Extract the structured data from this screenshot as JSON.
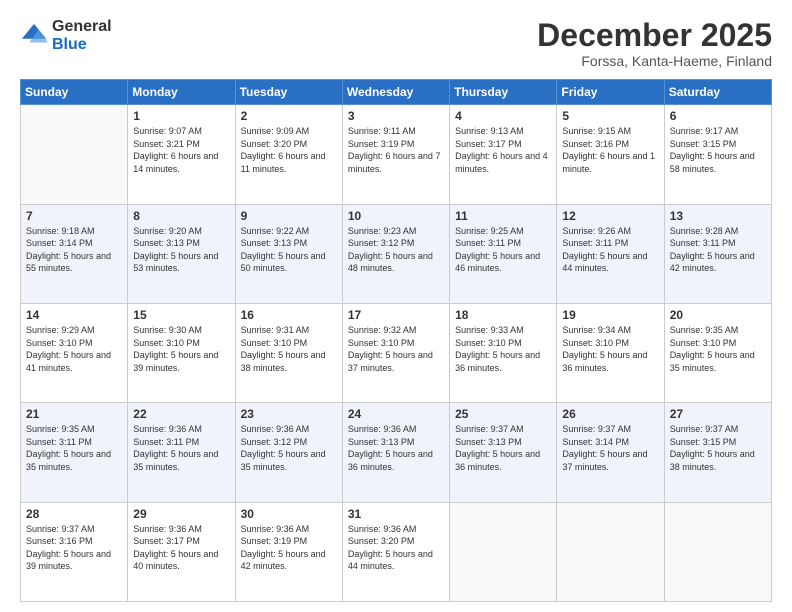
{
  "logo": {
    "general": "General",
    "blue": "Blue"
  },
  "header": {
    "month": "December 2025",
    "location": "Forssa, Kanta-Haeme, Finland"
  },
  "weekdays": [
    "Sunday",
    "Monday",
    "Tuesday",
    "Wednesday",
    "Thursday",
    "Friday",
    "Saturday"
  ],
  "weeks": [
    [
      {
        "day": "",
        "sunrise": "",
        "sunset": "",
        "daylight": ""
      },
      {
        "day": "1",
        "sunrise": "Sunrise: 9:07 AM",
        "sunset": "Sunset: 3:21 PM",
        "daylight": "Daylight: 6 hours and 14 minutes."
      },
      {
        "day": "2",
        "sunrise": "Sunrise: 9:09 AM",
        "sunset": "Sunset: 3:20 PM",
        "daylight": "Daylight: 6 hours and 11 minutes."
      },
      {
        "day": "3",
        "sunrise": "Sunrise: 9:11 AM",
        "sunset": "Sunset: 3:19 PM",
        "daylight": "Daylight: 6 hours and 7 minutes."
      },
      {
        "day": "4",
        "sunrise": "Sunrise: 9:13 AM",
        "sunset": "Sunset: 3:17 PM",
        "daylight": "Daylight: 6 hours and 4 minutes."
      },
      {
        "day": "5",
        "sunrise": "Sunrise: 9:15 AM",
        "sunset": "Sunset: 3:16 PM",
        "daylight": "Daylight: 6 hours and 1 minute."
      },
      {
        "day": "6",
        "sunrise": "Sunrise: 9:17 AM",
        "sunset": "Sunset: 3:15 PM",
        "daylight": "Daylight: 5 hours and 58 minutes."
      }
    ],
    [
      {
        "day": "7",
        "sunrise": "Sunrise: 9:18 AM",
        "sunset": "Sunset: 3:14 PM",
        "daylight": "Daylight: 5 hours and 55 minutes."
      },
      {
        "day": "8",
        "sunrise": "Sunrise: 9:20 AM",
        "sunset": "Sunset: 3:13 PM",
        "daylight": "Daylight: 5 hours and 53 minutes."
      },
      {
        "day": "9",
        "sunrise": "Sunrise: 9:22 AM",
        "sunset": "Sunset: 3:13 PM",
        "daylight": "Daylight: 5 hours and 50 minutes."
      },
      {
        "day": "10",
        "sunrise": "Sunrise: 9:23 AM",
        "sunset": "Sunset: 3:12 PM",
        "daylight": "Daylight: 5 hours and 48 minutes."
      },
      {
        "day": "11",
        "sunrise": "Sunrise: 9:25 AM",
        "sunset": "Sunset: 3:11 PM",
        "daylight": "Daylight: 5 hours and 46 minutes."
      },
      {
        "day": "12",
        "sunrise": "Sunrise: 9:26 AM",
        "sunset": "Sunset: 3:11 PM",
        "daylight": "Daylight: 5 hours and 44 minutes."
      },
      {
        "day": "13",
        "sunrise": "Sunrise: 9:28 AM",
        "sunset": "Sunset: 3:11 PM",
        "daylight": "Daylight: 5 hours and 42 minutes."
      }
    ],
    [
      {
        "day": "14",
        "sunrise": "Sunrise: 9:29 AM",
        "sunset": "Sunset: 3:10 PM",
        "daylight": "Daylight: 5 hours and 41 minutes."
      },
      {
        "day": "15",
        "sunrise": "Sunrise: 9:30 AM",
        "sunset": "Sunset: 3:10 PM",
        "daylight": "Daylight: 5 hours and 39 minutes."
      },
      {
        "day": "16",
        "sunrise": "Sunrise: 9:31 AM",
        "sunset": "Sunset: 3:10 PM",
        "daylight": "Daylight: 5 hours and 38 minutes."
      },
      {
        "day": "17",
        "sunrise": "Sunrise: 9:32 AM",
        "sunset": "Sunset: 3:10 PM",
        "daylight": "Daylight: 5 hours and 37 minutes."
      },
      {
        "day": "18",
        "sunrise": "Sunrise: 9:33 AM",
        "sunset": "Sunset: 3:10 PM",
        "daylight": "Daylight: 5 hours and 36 minutes."
      },
      {
        "day": "19",
        "sunrise": "Sunrise: 9:34 AM",
        "sunset": "Sunset: 3:10 PM",
        "daylight": "Daylight: 5 hours and 36 minutes."
      },
      {
        "day": "20",
        "sunrise": "Sunrise: 9:35 AM",
        "sunset": "Sunset: 3:10 PM",
        "daylight": "Daylight: 5 hours and 35 minutes."
      }
    ],
    [
      {
        "day": "21",
        "sunrise": "Sunrise: 9:35 AM",
        "sunset": "Sunset: 3:11 PM",
        "daylight": "Daylight: 5 hours and 35 minutes."
      },
      {
        "day": "22",
        "sunrise": "Sunrise: 9:36 AM",
        "sunset": "Sunset: 3:11 PM",
        "daylight": "Daylight: 5 hours and 35 minutes."
      },
      {
        "day": "23",
        "sunrise": "Sunrise: 9:36 AM",
        "sunset": "Sunset: 3:12 PM",
        "daylight": "Daylight: 5 hours and 35 minutes."
      },
      {
        "day": "24",
        "sunrise": "Sunrise: 9:36 AM",
        "sunset": "Sunset: 3:13 PM",
        "daylight": "Daylight: 5 hours and 36 minutes."
      },
      {
        "day": "25",
        "sunrise": "Sunrise: 9:37 AM",
        "sunset": "Sunset: 3:13 PM",
        "daylight": "Daylight: 5 hours and 36 minutes."
      },
      {
        "day": "26",
        "sunrise": "Sunrise: 9:37 AM",
        "sunset": "Sunset: 3:14 PM",
        "daylight": "Daylight: 5 hours and 37 minutes."
      },
      {
        "day": "27",
        "sunrise": "Sunrise: 9:37 AM",
        "sunset": "Sunset: 3:15 PM",
        "daylight": "Daylight: 5 hours and 38 minutes."
      }
    ],
    [
      {
        "day": "28",
        "sunrise": "Sunrise: 9:37 AM",
        "sunset": "Sunset: 3:16 PM",
        "daylight": "Daylight: 5 hours and 39 minutes."
      },
      {
        "day": "29",
        "sunrise": "Sunrise: 9:36 AM",
        "sunset": "Sunset: 3:17 PM",
        "daylight": "Daylight: 5 hours and 40 minutes."
      },
      {
        "day": "30",
        "sunrise": "Sunrise: 9:36 AM",
        "sunset": "Sunset: 3:19 PM",
        "daylight": "Daylight: 5 hours and 42 minutes."
      },
      {
        "day": "31",
        "sunrise": "Sunrise: 9:36 AM",
        "sunset": "Sunset: 3:20 PM",
        "daylight": "Daylight: 5 hours and 44 minutes."
      },
      {
        "day": "",
        "sunrise": "",
        "sunset": "",
        "daylight": ""
      },
      {
        "day": "",
        "sunrise": "",
        "sunset": "",
        "daylight": ""
      },
      {
        "day": "",
        "sunrise": "",
        "sunset": "",
        "daylight": ""
      }
    ]
  ]
}
